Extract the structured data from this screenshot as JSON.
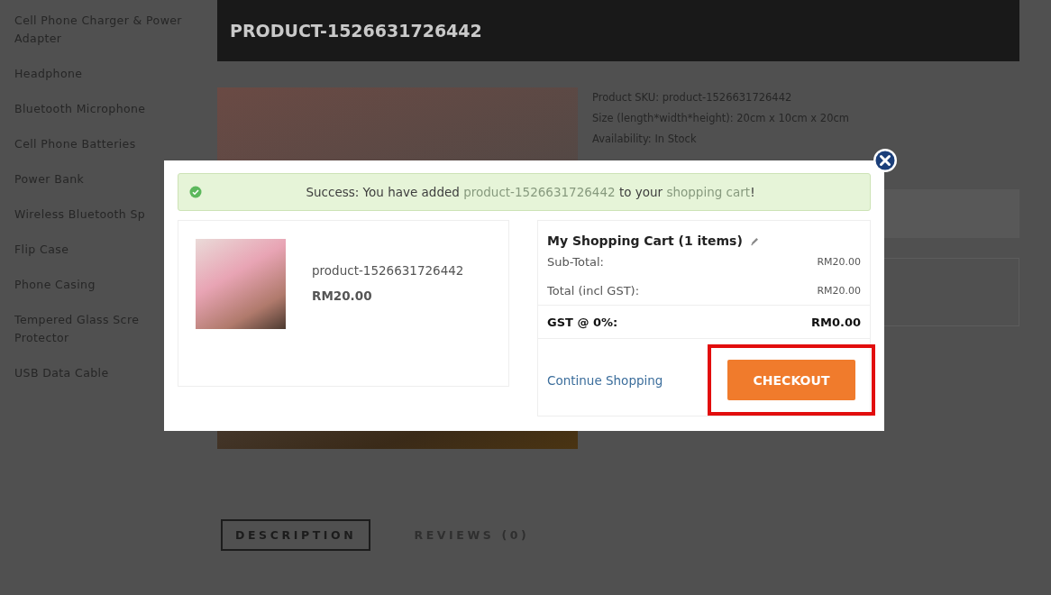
{
  "sidebar": {
    "items": [
      "Cell Phone Charger & Power Adapter",
      "Headphone",
      "Bluetooth Microphone",
      "Cell Phone Batteries",
      "Power Bank",
      "Wireless Bluetooth Sp",
      "Flip Case",
      "Phone Casing",
      "Tempered Glass Scre\nProtector",
      "USB Data Cable"
    ]
  },
  "product": {
    "title": "PRODUCT-1526631726442",
    "details": [
      "Product SKU: product-1526631726442",
      "Size (length*width*height): 20cm x 10cm x 20cm",
      "Availability: In Stock"
    ]
  },
  "tabs": [
    {
      "label": "DESCRIPTION",
      "selected": true
    },
    {
      "label": "REVIEWS (0)",
      "selected": false
    }
  ],
  "modal": {
    "alert": {
      "prefix": "Success: You have added ",
      "product_link": "product-1526631726442",
      "middle": " to your ",
      "cart_link": "shopping cart",
      "suffix": "!"
    },
    "item": {
      "name": "product-1526631726442",
      "price": "RM20.00"
    },
    "cart": {
      "title": "My Shopping Cart (1 items)",
      "totals": [
        {
          "label": "Sub-Total:",
          "value": "RM20.00",
          "kind": "plain"
        },
        {
          "label": "Total (incl GST):",
          "value": "RM20.00",
          "kind": "plain"
        },
        {
          "label": "GST @ 0%:",
          "value": "RM0.00",
          "kind": "bold"
        }
      ]
    },
    "continue": "Continue Shopping",
    "checkout": {
      "label": "CHECKOUT",
      "highlighted": true
    }
  }
}
